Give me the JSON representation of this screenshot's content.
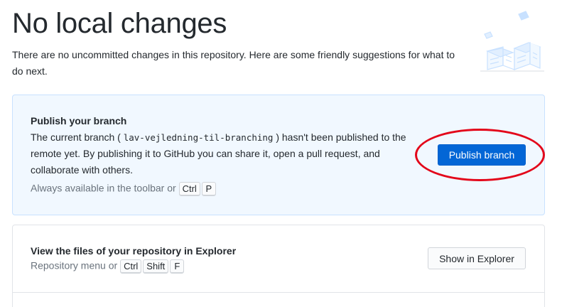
{
  "header": {
    "title": "No local changes",
    "subtitle": "There are no uncommitted changes in this repository. Here are some friendly suggestions for what to do next."
  },
  "publish": {
    "title": "Publish your branch",
    "text_before": "The current branch (",
    "branch": "lav-vejledning-til-branching",
    "text_after": ") hasn't been published to the remote yet. By publishing it to GitHub you can share it, open a pull request, and collaborate with others.",
    "shortcut_label": "Always available in the toolbar or",
    "keys": [
      "Ctrl",
      "P"
    ],
    "button_label": "Publish branch"
  },
  "explorer": {
    "title": "View the files of your repository in Explorer",
    "shortcut_label": "Repository menu or",
    "keys": [
      "Ctrl",
      "Shift",
      "F"
    ],
    "button_label": "Show in Explorer"
  },
  "colors": {
    "accent": "#0366d6",
    "highlight_circle": "#e3061a",
    "publish_bg": "#f1f8ff"
  }
}
